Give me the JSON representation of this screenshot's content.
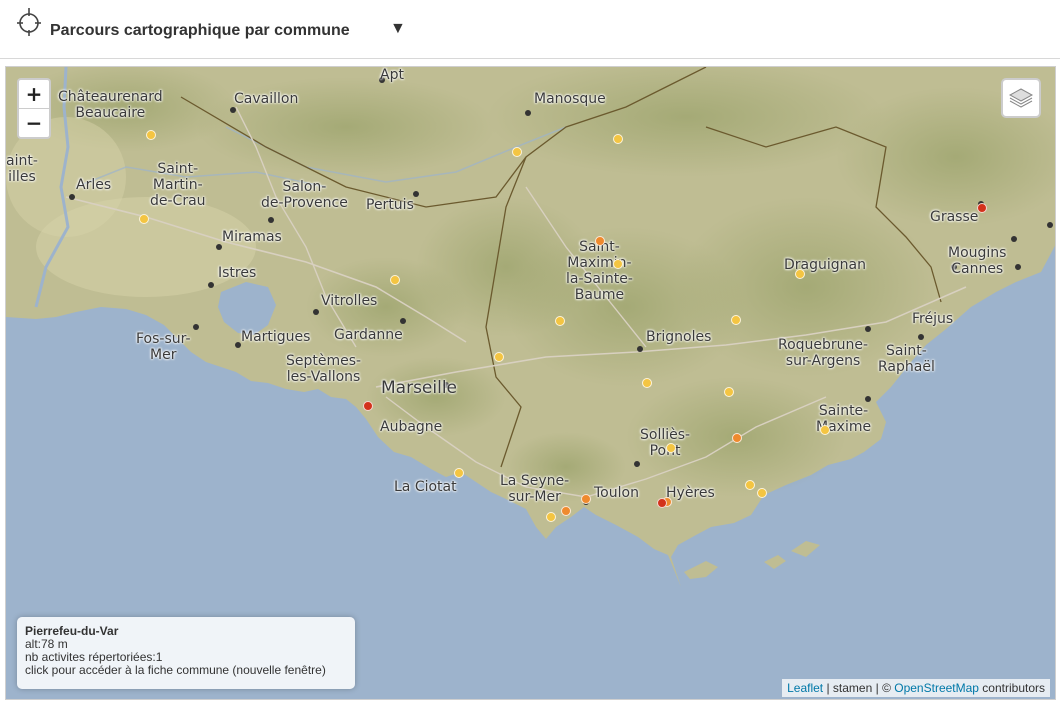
{
  "header": {
    "title": "Parcours cartographique par commune",
    "dropdown_caret": "▼",
    "logo_icon": "crosshair-icon"
  },
  "map": {
    "zoom_in": "+",
    "zoom_out": "−",
    "layers_icon": "layers-icon",
    "colors": {
      "sea": "#9db3cc",
      "land": "#b9b78e",
      "marker_yellow": "#f4c542",
      "marker_orange": "#ef8a2e",
      "marker_red": "#d3321b"
    },
    "cities": [
      {
        "label": "Châteaurenard\nBeaucaire"
      },
      {
        "label": "Cavaillon"
      },
      {
        "label": "Apt"
      },
      {
        "label": "Manosque"
      },
      {
        "label": "aint-\nilles"
      },
      {
        "label": "Arles"
      },
      {
        "label": "Saint-\nMartin-\nde-Crau"
      },
      {
        "label": "Salon-\nde-Provence"
      },
      {
        "label": "Pertuis"
      },
      {
        "label": "Miramas"
      },
      {
        "label": "Istres"
      },
      {
        "label": "Vitrolles"
      },
      {
        "label": "Gardanne"
      },
      {
        "label": "Martigues"
      },
      {
        "label": "Fos-sur-\nMer"
      },
      {
        "label": "Septèmes-\nles-Vallons"
      },
      {
        "label": "Marseille"
      },
      {
        "label": "Aubagne"
      },
      {
        "label": "La Ciotat"
      },
      {
        "label": "Saint-\nMaximin-\nla-Sainte-\nBaume"
      },
      {
        "label": "Brignoles"
      },
      {
        "label": "Draguignan"
      },
      {
        "label": "Grasse"
      },
      {
        "label": "Mougins\nCannes"
      },
      {
        "label": "Fréjus"
      },
      {
        "label": "Roquebrune-\nsur-Argens"
      },
      {
        "label": "Saint-\nRaphaël"
      },
      {
        "label": "Sainte-\nMaxime"
      },
      {
        "label": "Solliès-\nPont"
      },
      {
        "label": "La Seyne-\nsur-Mer"
      },
      {
        "label": "Toulon"
      },
      {
        "label": "Hyères"
      }
    ],
    "markers": [
      {
        "color": "yellow"
      },
      {
        "color": "yellow"
      },
      {
        "color": "yellow"
      },
      {
        "color": "yellow"
      },
      {
        "color": "orange"
      },
      {
        "color": "yellow"
      },
      {
        "color": "yellow"
      },
      {
        "color": "yellow"
      },
      {
        "color": "yellow"
      },
      {
        "color": "yellow"
      },
      {
        "color": "yellow"
      },
      {
        "color": "yellow"
      },
      {
        "color": "red"
      },
      {
        "color": "yellow"
      },
      {
        "color": "yellow"
      },
      {
        "color": "orange"
      },
      {
        "color": "yellow"
      },
      {
        "color": "red"
      },
      {
        "color": "orange"
      },
      {
        "color": "orange"
      },
      {
        "color": "yellow"
      },
      {
        "color": "yellow"
      },
      {
        "color": "orange"
      },
      {
        "color": "yellow"
      },
      {
        "color": "yellow"
      },
      {
        "color": "red"
      }
    ],
    "info": {
      "name": "Pierrefeu-du-Var",
      "altitude": "alt:78 m",
      "activities": "nb activites répertoriées:1",
      "hint": "click pour accéder à la fiche commune (nouvelle fenêtre)"
    },
    "attribution": {
      "leaflet": "Leaflet",
      "stamen": " | stamen | © ",
      "osm": "OpenStreetMap",
      "contributors": " contributors"
    }
  }
}
